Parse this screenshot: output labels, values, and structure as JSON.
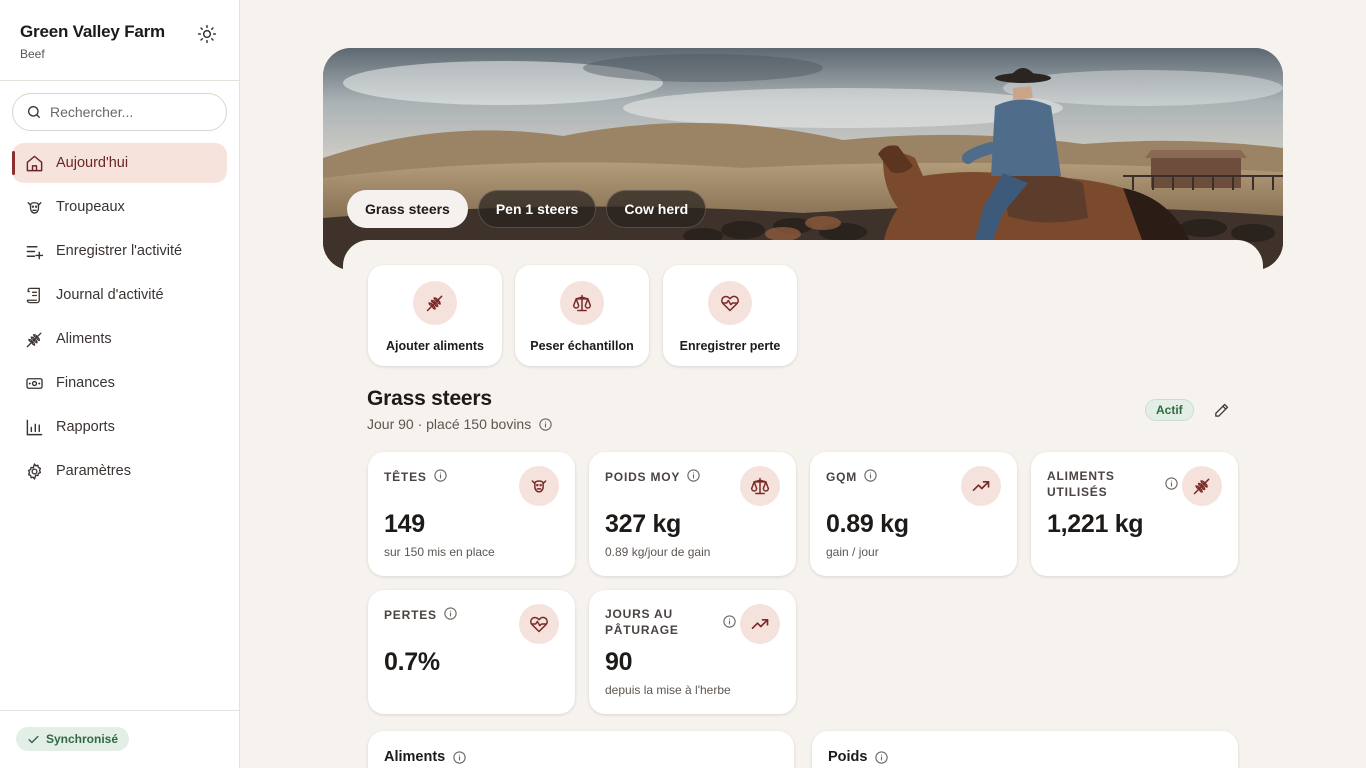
{
  "sidebar": {
    "brand_name": "Green Valley Farm",
    "brand_sub": "Beef",
    "theme_icon": "sun-icon",
    "search_placeholder": "Rechercher...",
    "items": [
      {
        "label": "Aujourd'hui",
        "icon": "home-icon",
        "active": true
      },
      {
        "label": "Troupeaux",
        "icon": "cow-icon"
      },
      {
        "label": "Enregistrer l'activité",
        "icon": "list-plus-icon"
      },
      {
        "label": "Journal d'activité",
        "icon": "scroll-icon"
      },
      {
        "label": "Aliments",
        "icon": "wheat-icon"
      },
      {
        "label": "Finances",
        "icon": "banknote-icon"
      },
      {
        "label": "Rapports",
        "icon": "bar-chart-icon"
      },
      {
        "label": "Paramètres",
        "icon": "gear-icon"
      }
    ],
    "sync_label": "Synchronisé"
  },
  "hero": {
    "tabs": [
      "Grass steers",
      "Pen 1 steers",
      "Cow herd"
    ],
    "active_tab": 0
  },
  "quick_actions": [
    {
      "label": "Ajouter aliments",
      "icon": "wheat-icon"
    },
    {
      "label": "Peser échantillon",
      "icon": "scale-icon"
    },
    {
      "label": "Enregistrer perte",
      "icon": "heart-pulse-icon"
    }
  ],
  "group": {
    "title": "Grass steers",
    "subtitle": "Jour 90 · placé 150 bovins",
    "status": "Actif"
  },
  "stats": [
    {
      "head": "Têtes",
      "value": "149",
      "note": "sur 150 mis en place",
      "icon": "cow-icon"
    },
    {
      "head": "Poids moy",
      "value": "327 kg",
      "note": "0.89 kg/jour de gain",
      "icon": "scale-icon"
    },
    {
      "head": "GQM",
      "value": "0.89 kg",
      "note": "gain / jour",
      "icon": "trending-up-icon"
    },
    {
      "head": "Aliments utilisés",
      "value": "1,221 kg",
      "note": "",
      "icon": "wheat-icon"
    },
    {
      "head": "Pertes",
      "value": "0.7%",
      "note": "",
      "icon": "heart-pulse-icon"
    },
    {
      "head": "Jours au pâturage",
      "value": "90",
      "note": "depuis la mise à l'herbe",
      "icon": "trending-up-icon"
    }
  ],
  "bottom_cards": [
    {
      "title": "Aliments"
    },
    {
      "title": "Poids"
    }
  ],
  "colors": {
    "accent": "#8d2f2d",
    "accent_soft": "#f5e2dc",
    "success": "#2f6a42",
    "background": "#f6f2ee"
  }
}
